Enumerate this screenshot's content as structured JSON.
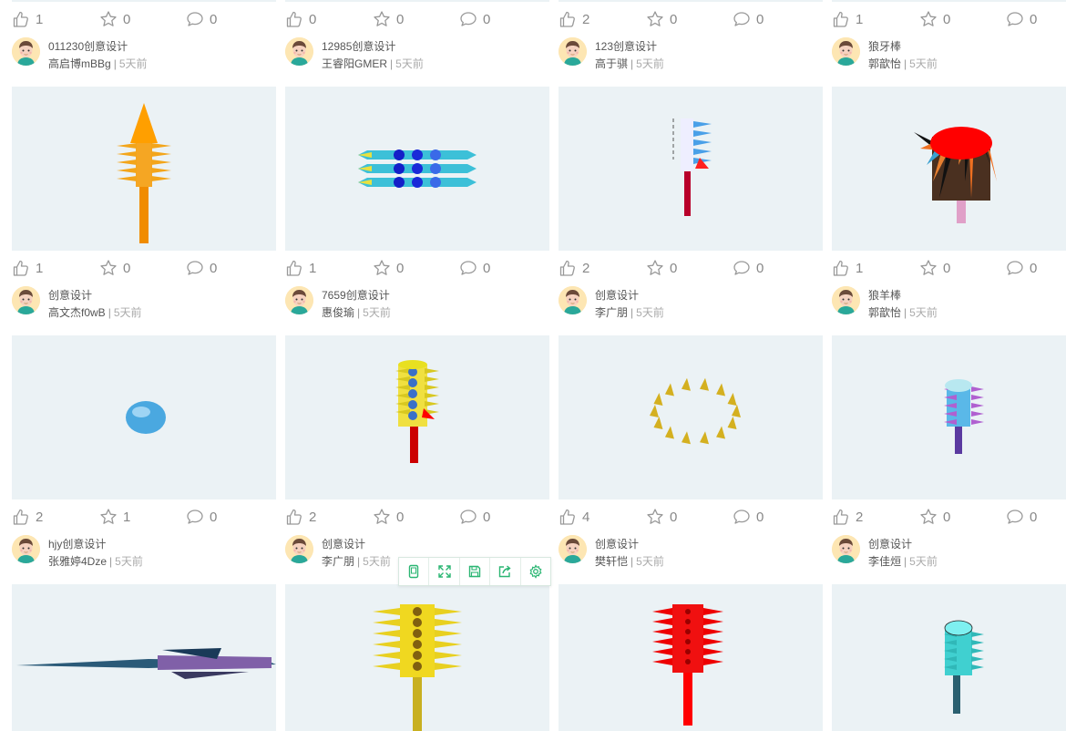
{
  "cards": [
    {
      "stats": {
        "likes": "1",
        "stars": "0",
        "comments": "0"
      },
      "title": "011230创意设计",
      "user": "高启博mBBg",
      "time": "5天前"
    },
    {
      "stats": {
        "likes": "0",
        "stars": "0",
        "comments": "0"
      },
      "title": "12985创意设计",
      "user": "王睿阳GMER",
      "time": "5天前"
    },
    {
      "stats": {
        "likes": "2",
        "stars": "0",
        "comments": "0"
      },
      "title": "123创意设计",
      "user": "高于骐",
      "time": "5天前"
    },
    {
      "stats": {
        "likes": "1",
        "stars": "0",
        "comments": "0"
      },
      "title": "狼牙棒",
      "user": "郭歆怡",
      "time": "5天前"
    },
    {
      "stats": {
        "likes": "1",
        "stars": "0",
        "comments": "0"
      },
      "title": "创意设计",
      "user": "高文杰f0wB",
      "time": "5天前"
    },
    {
      "stats": {
        "likes": "1",
        "stars": "0",
        "comments": "0"
      },
      "title": "7659创意设计",
      "user": "惠俊瑜",
      "time": "5天前"
    },
    {
      "stats": {
        "likes": "2",
        "stars": "0",
        "comments": "0"
      },
      "title": "创意设计",
      "user": "李广朋",
      "time": "5天前"
    },
    {
      "stats": {
        "likes": "1",
        "stars": "0",
        "comments": "0"
      },
      "title": "狼羊棒",
      "user": "郭歆怡",
      "time": "5天前"
    },
    {
      "stats": {
        "likes": "2",
        "stars": "1",
        "comments": "0"
      },
      "title": "hjy创意设计",
      "user": "张雅婷4Dze",
      "time": "5天前"
    },
    {
      "stats": {
        "likes": "2",
        "stars": "0",
        "comments": "0"
      },
      "title": "创意设计",
      "user": "李广朋",
      "time": "5天前"
    },
    {
      "stats": {
        "likes": "4",
        "stars": "0",
        "comments": "0"
      },
      "title": "创意设计",
      "user": "樊轩恺",
      "time": "5天前"
    },
    {
      "stats": {
        "likes": "2",
        "stars": "0",
        "comments": "0"
      },
      "title": "创意设计",
      "user": "李佳烜",
      "time": "5天前"
    }
  ],
  "bottom_stats": [
    {
      "likes": "2",
      "stars": "1",
      "comments": "0"
    },
    {
      "likes": "2",
      "stars": "0",
      "comments": "0"
    },
    {
      "likes": "4",
      "stars": "0",
      "comments": "0"
    },
    {
      "likes": "2",
      "stars": "0",
      "comments": "0"
    }
  ],
  "toolbar": {
    "items": [
      "phone-view-icon",
      "fullscreen-icon",
      "save-icon",
      "share-icon",
      "settings-icon"
    ]
  },
  "colors": {
    "accent": "#2bb673",
    "thumb_bg": "#ebf2f5",
    "muted": "#999999"
  }
}
